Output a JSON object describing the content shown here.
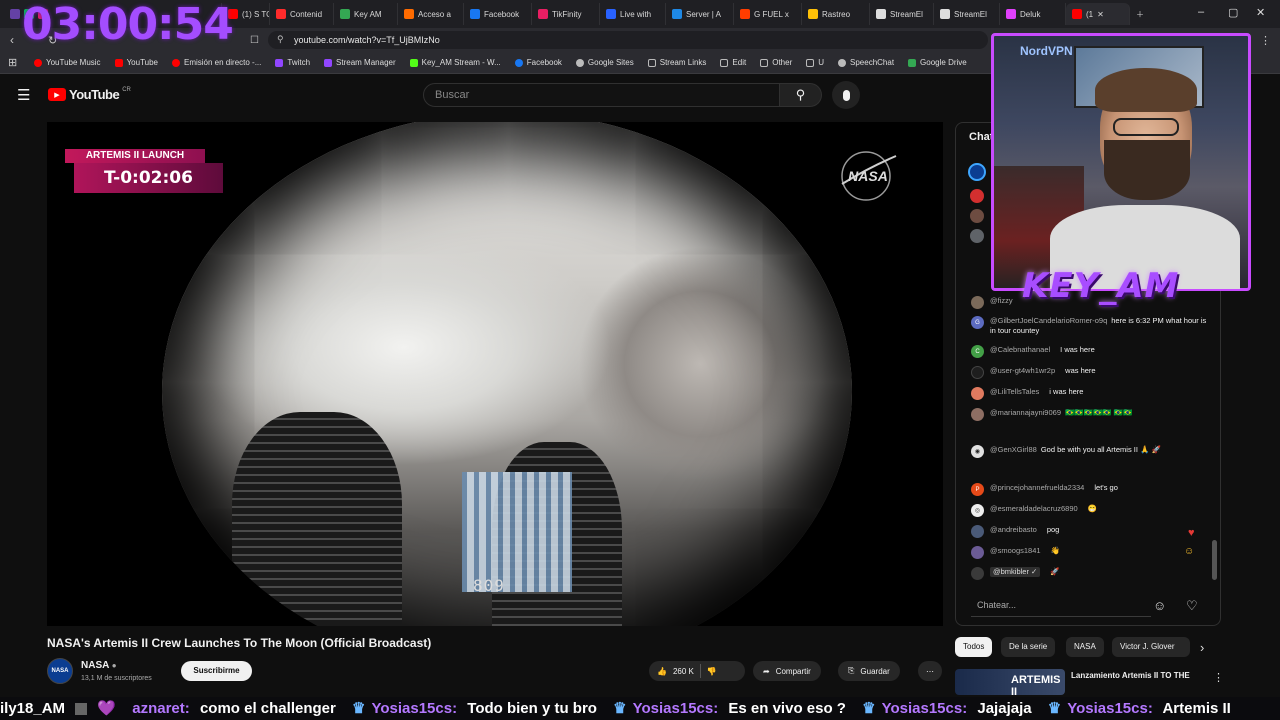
{
  "browser": {
    "tabs": [
      "(1) S TO",
      "Contenid",
      "Key AM",
      "Acceso a",
      "Facebook",
      "TikFinity",
      "Live with",
      "Server | A",
      "G FUEL x",
      "Rastreo",
      "StreamEl",
      "StreamEl",
      "Deluk",
      "(1"
    ],
    "url": "youtube.com/watch?v=Tf_UjBMIzNo",
    "bookmarks": [
      "YouTube Music",
      "YouTube",
      "Emisión en directo -...",
      "Twitch",
      "Stream Manager",
      "Key_AM Stream - W...",
      "Facebook",
      "Google Sites",
      "Stream Links",
      "Edit",
      "Other",
      "U",
      "SpeechChat",
      "Google Drive"
    ]
  },
  "overlay": {
    "timer": "03:00:54",
    "webcam_name": "KEY_AM",
    "nordvpn": "NordVPN"
  },
  "youtube": {
    "logo_text": "YouTube",
    "logo_region": "CR",
    "search_placeholder": "Buscar",
    "video": {
      "badge_title": "ARTEMIS II LAUNCH",
      "countdown": "T-0:02:06",
      "logo": "NASA",
      "counter": "809",
      "title": "NASA's Artemis II Crew Launches To The Moon (Official Broadcast)"
    },
    "channel": {
      "name": "NASA",
      "subscribers": "13,1 M de suscriptores",
      "subscribe_label": "Suscribirme"
    },
    "actions": {
      "likes": "260 K",
      "share": "Compartir",
      "save": "Guardar"
    },
    "chat": {
      "header": "Chat",
      "input_placeholder": "Chatear...",
      "messages": [
        {
          "user": "@fizzy",
          "text": ""
        },
        {
          "user": "@GilbertJoelCandelarioRomer-o9q",
          "text": "here is 6:32 PM what hour is in tour countey"
        },
        {
          "user": "@Calebnathanael",
          "text": "I was here"
        },
        {
          "user": "@user-gt4wh1wr2p",
          "text": "was here"
        },
        {
          "user": "@LiliTellsTales",
          "text": "i was here"
        },
        {
          "user": "@mariannajayni9069",
          "text": "🇧🇷🇧🇷🇧🇷🇧🇷🇧🇷 🇧🇷🇧🇷"
        },
        {
          "user": "@GenXGirl88",
          "text": "God be with you all Artemis II 🙏 🚀"
        },
        {
          "user": "@princejohannefruelda2334",
          "text": "let's go"
        },
        {
          "user": "@esmeraldadelacruz6890",
          "text": "😁"
        },
        {
          "user": "@andreibasto",
          "text": "pog"
        },
        {
          "user": "@smoogs1841",
          "text": "👋"
        },
        {
          "user": "@bmkibler ✓",
          "text": "🚀"
        }
      ]
    },
    "chips": [
      "Todos",
      "De la serie",
      "NASA",
      "Victor J. Glover"
    ],
    "related": {
      "thumb_text": "ARTEMIS II",
      "title": "Lanzamiento Artemis II TO THE"
    }
  },
  "ticker": [
    {
      "name": "ily18_AM",
      "msg": "💜"
    },
    {
      "name": "aznaret:",
      "msg": "como el challenger"
    },
    {
      "name": "Yosias15cs:",
      "msg": "Todo bien y tu bro"
    },
    {
      "name": "Yosias15cs:",
      "msg": "Es en vivo eso ?"
    },
    {
      "name": "Yosias15cs:",
      "msg": "Jajajaja"
    },
    {
      "name": "Yosias15cs:",
      "msg": "Artemis II"
    }
  ],
  "colors": {
    "accent_purple": "#a44dff",
    "nasa_badge": "#c2185b",
    "yt_red": "#ff0000"
  }
}
